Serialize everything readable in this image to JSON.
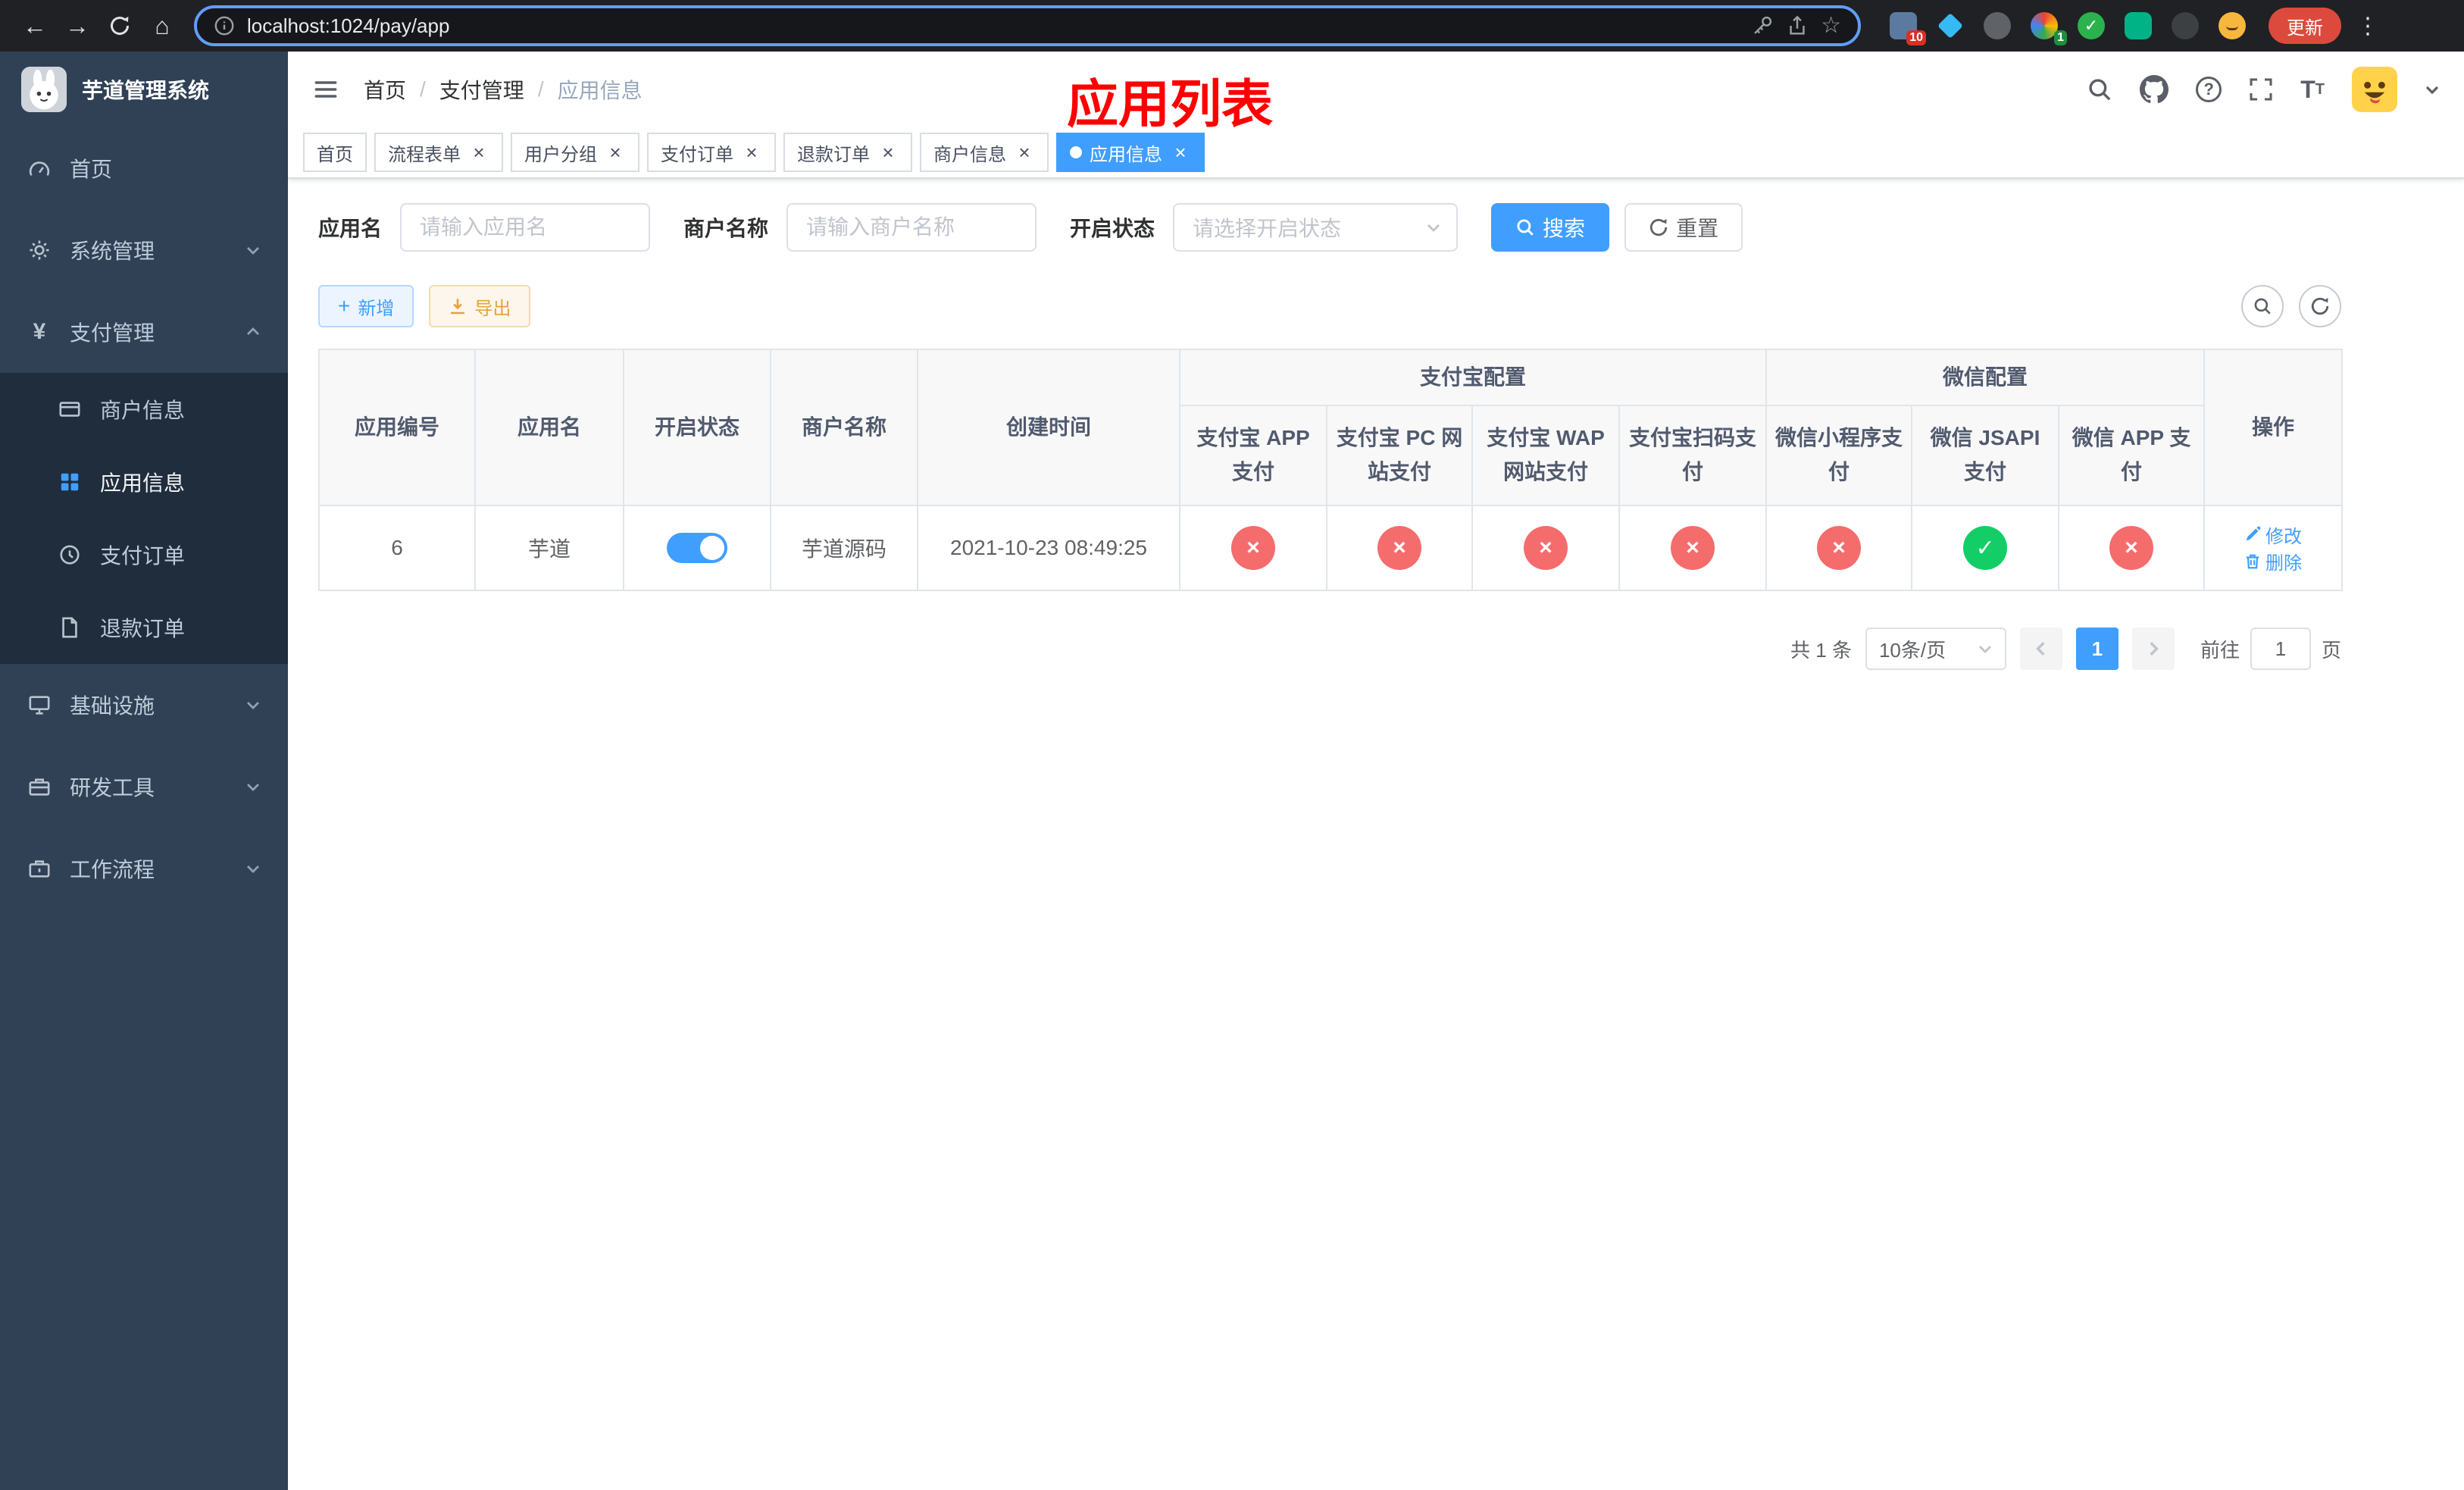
{
  "browser": {
    "url": "localhost:1024/pay/app",
    "update_button": "更新",
    "badges": {
      "ext1": "10",
      "ext4": "1"
    }
  },
  "sidebar": {
    "title": "芋道管理系统",
    "items": [
      {
        "label": "首页",
        "icon": "dashboard-icon"
      },
      {
        "label": "系统管理",
        "icon": "gear-icon"
      },
      {
        "label": "支付管理",
        "icon": "yen-icon",
        "expanded": true,
        "children": [
          {
            "label": "商户信息",
            "icon": "card-icon"
          },
          {
            "label": "应用信息",
            "icon": "grid-icon",
            "active": true
          },
          {
            "label": "支付订单",
            "icon": "order-icon"
          },
          {
            "label": "退款订单",
            "icon": "refund-icon"
          }
        ]
      },
      {
        "label": "基础设施",
        "icon": "monitor-icon"
      },
      {
        "label": "研发工具",
        "icon": "toolbox-icon"
      },
      {
        "label": "工作流程",
        "icon": "workflow-icon"
      }
    ]
  },
  "header": {
    "breadcrumb": [
      "首页",
      "支付管理",
      "应用信息"
    ],
    "breadcrumb_separator": "/",
    "page_title": "应用列表",
    "icons": [
      "search-icon",
      "github-icon",
      "question-icon",
      "fullscreen-icon",
      "font-size-icon",
      "avatar",
      "caret-down-icon"
    ]
  },
  "tabs": [
    {
      "label": "首页"
    },
    {
      "label": "流程表单"
    },
    {
      "label": "用户分组"
    },
    {
      "label": "支付订单"
    },
    {
      "label": "退款订单"
    },
    {
      "label": "商户信息"
    },
    {
      "label": "应用信息",
      "active": true
    }
  ],
  "filters": {
    "app_name_label": "应用名",
    "app_name_placeholder": "请输入应用名",
    "merchant_label": "商户名称",
    "merchant_placeholder": "请输入商户名称",
    "status_label": "开启状态",
    "status_placeholder": "请选择开启状态",
    "search_button": "搜索",
    "reset_button": "重置"
  },
  "toolbar": {
    "add_button": "新增",
    "export_button": "导出"
  },
  "table": {
    "columns": [
      "应用编号",
      "应用名",
      "开启状态",
      "商户名称",
      "创建时间"
    ],
    "group_alipay": "支付宝配置",
    "group_wechat": "微信配置",
    "alipay_columns": [
      "支付宝 APP 支付",
      "支付宝 PC 网站支付",
      "支付宝 WAP 网站支付",
      "支付宝扫码支付"
    ],
    "wechat_columns": [
      "微信小程序支付",
      "微信 JSAPI 支付",
      "微信 APP 支付"
    ],
    "actions_column": "操作",
    "rows": [
      {
        "id": "6",
        "name": "芋道",
        "status_on": true,
        "merchant": "芋道源码",
        "created": "2021-10-23 08:49:25",
        "alipay": [
          false,
          false,
          false,
          false
        ],
        "wechat": [
          false,
          true,
          false
        ],
        "actions": [
          "修改",
          "删除"
        ]
      }
    ]
  },
  "pagination": {
    "total": "共 1 条",
    "page_size": "10条/页",
    "current_page": "1",
    "goto_label": "前往",
    "goto_value": "1",
    "page_unit": "页"
  },
  "colors": {
    "primary": "#409eff",
    "success": "#13ce66",
    "danger": "#f56c6c",
    "warning": "#e6a23c",
    "sidebar_bg": "#304156",
    "submenu_bg": "#1f2d3d",
    "title_red": "#ff0000"
  }
}
